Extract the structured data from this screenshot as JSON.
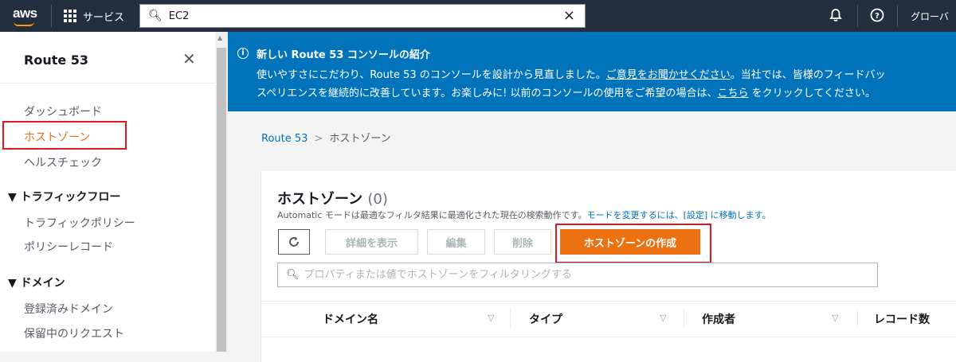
{
  "topbar": {
    "logo_text": "aws",
    "services_label": "サービス",
    "search_value": "EC2",
    "clear_icon": "×",
    "bell_icon": "bell-icon",
    "help_icon": "help-icon",
    "region_label": "グローバ"
  },
  "sidebar": {
    "title": "Route 53",
    "items": [
      {
        "label": "ダッシュボード"
      },
      {
        "label": "ホストゾーン"
      },
      {
        "label": "ヘルスチェック"
      }
    ],
    "sections": [
      {
        "label": "▼ トラフィックフロー",
        "items": [
          {
            "label": "トラフィックポリシー"
          },
          {
            "label": "ポリシーレコード"
          }
        ]
      },
      {
        "label": "▼ ドメイン",
        "items": [
          {
            "label": "登録済みドメイン"
          },
          {
            "label": "保留中のリクエスト"
          }
        ]
      }
    ]
  },
  "banner": {
    "title": "新しい Route 53 コンソールの紹介",
    "line1_prefix": "使いやすさにこだわり、Route 53 のコンソールを設計から見直しました。",
    "line1_link": "ご意見をお聞かせください",
    "line1_suffix": "。当社では、皆様のフィードバッ",
    "line2_prefix": "スペリエンスを継続的に改善しています。お楽しみに! 以前のコンソールの使用をご希望の場合は、",
    "line2_link": "こちら",
    "line2_suffix": " をクリックしてください。"
  },
  "breadcrumb": {
    "root": "Route 53",
    "current": "ホストゾーン"
  },
  "panel": {
    "title": "ホストゾーン",
    "count": "(0)",
    "desc_prefix": "Automatic モードは最適なフィルタ結果に最適化された現在の検索動作です。",
    "desc_link": "モードを変更するには、[設定] に移動します。",
    "buttons": {
      "details": "詳細を表示",
      "edit": "編集",
      "delete": "削除",
      "create": "ホストゾーンの作成"
    },
    "filter_placeholder": "プロパティまたは値でホストゾーンをフィルタリングする",
    "columns": [
      "ドメイン名",
      "タイプ",
      "作成者",
      "レコード数"
    ]
  }
}
